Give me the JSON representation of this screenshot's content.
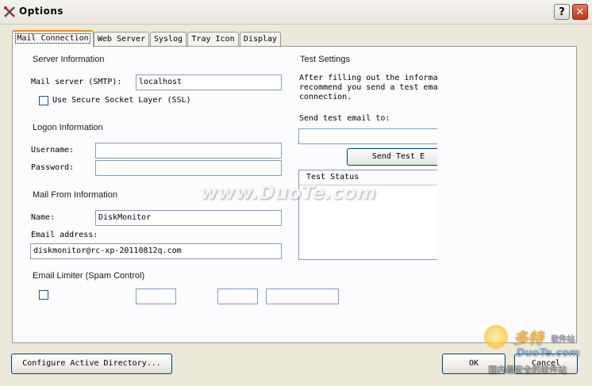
{
  "window": {
    "title": "Options",
    "help_label": "?",
    "close_label": "✕",
    "icon": "tools-icon"
  },
  "tabs": [
    {
      "label": "Mail Connection",
      "active": true
    },
    {
      "label": "Web Server"
    },
    {
      "label": "Syslog"
    },
    {
      "label": "Tray Icon"
    },
    {
      "label": "Display"
    }
  ],
  "server_info": {
    "title": "Server Information",
    "smtp_label": "Mail server (SMTP):",
    "smtp_value": "localhost",
    "ssl_label": "Use Secure Socket Layer (SSL)",
    "ssl_checked": false
  },
  "logon_info": {
    "title": "Logon Information",
    "username_label": "Username:",
    "username_value": "",
    "password_label": "Password:",
    "password_value": ""
  },
  "mail_from": {
    "title": "Mail From Information",
    "name_label": "Name:",
    "name_value": "DiskMonitor",
    "email_label": "Email address:",
    "email_value": "diskmonitor@rc-xp-20110812q.com"
  },
  "limiter": {
    "title": "Email Limiter (Spam Control)"
  },
  "test_settings": {
    "title": "Test Settings",
    "description_lines": [
      "After filling out the informa",
      "recommend you send a test ema",
      "connection."
    ],
    "send_to_label": "Send test email to:",
    "send_to_value": "",
    "send_button": "Send Test E",
    "status_header": "Test Status"
  },
  "footer": {
    "configure_ad": "Configure Active Directory...",
    "ok": "OK",
    "cancel": "Cancel"
  },
  "watermarks": {
    "center": "www.DuoTe.com",
    "brand": "多特",
    "brand_suffix": "软件站",
    "brand_url": "DuoTe.com",
    "brand_tagline": "国内最安全的软件站"
  }
}
